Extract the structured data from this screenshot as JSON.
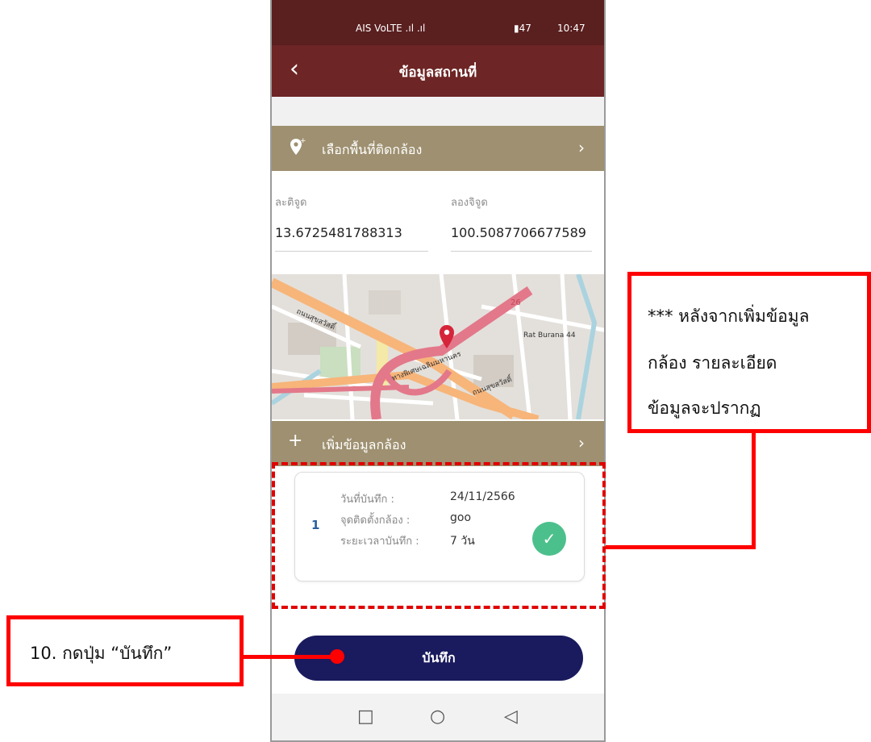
{
  "status_bar": {
    "left_text": "AIS VoLTE  .ıl .ıl",
    "time": "10:47",
    "battery": "47"
  },
  "app_bar": {
    "title": "ข้อมูลสถานที่",
    "back_icon": "chevron-left"
  },
  "select_area": {
    "icon": "location-plus-icon",
    "label": "เลือกพื้นที่ติดกล้อง",
    "chevron": "›"
  },
  "coordinates": {
    "lat_label": "ละติจูด",
    "lat_value": "13.6725481788313",
    "lng_label": "ลองจิจูด",
    "lng_value": "100.5087706677589"
  },
  "map": {
    "labels": [
      "ถนนสุขสวัสดิ์",
      "Rat Burana 44",
      "ทางพิเศษเฉลิมมหานคร",
      "ถนนสุขสวัสดิ์",
      "26"
    ]
  },
  "add_camera": {
    "icon": "+",
    "label": "เพิ่มข้อมูลกล้อง",
    "chevron": "›"
  },
  "camera_card": {
    "index": "1",
    "date_label": "วันที่บันทึก :",
    "date_value": "24/11/2566",
    "location_label": "จุดติดตั้งกล้อง :",
    "location_value": "goo",
    "duration_label": "ระยะเวลาบันทึก :",
    "duration_value": "7 วัน",
    "check_icon": "✓"
  },
  "save_button": {
    "label": "บันทึก"
  },
  "nav_bar": {
    "square": "□",
    "circle": "○",
    "back": "◁"
  },
  "annotations": {
    "note_line1": "*** หลังจากเพิ่มข้อมูล",
    "note_line2": "กล้อง รายละเอียด",
    "note_line3": "ข้อมูลจะปรากฏ",
    "step_label": "10. กดปุ่ม “บันทึก”"
  },
  "colors": {
    "status_bar": "#5a1f1f",
    "app_bar": "#6e2525",
    "section_bar": "#9e9070",
    "save_button": "#1a1a5e",
    "check": "#4cc08c",
    "annotation_red": "#ff0000"
  }
}
